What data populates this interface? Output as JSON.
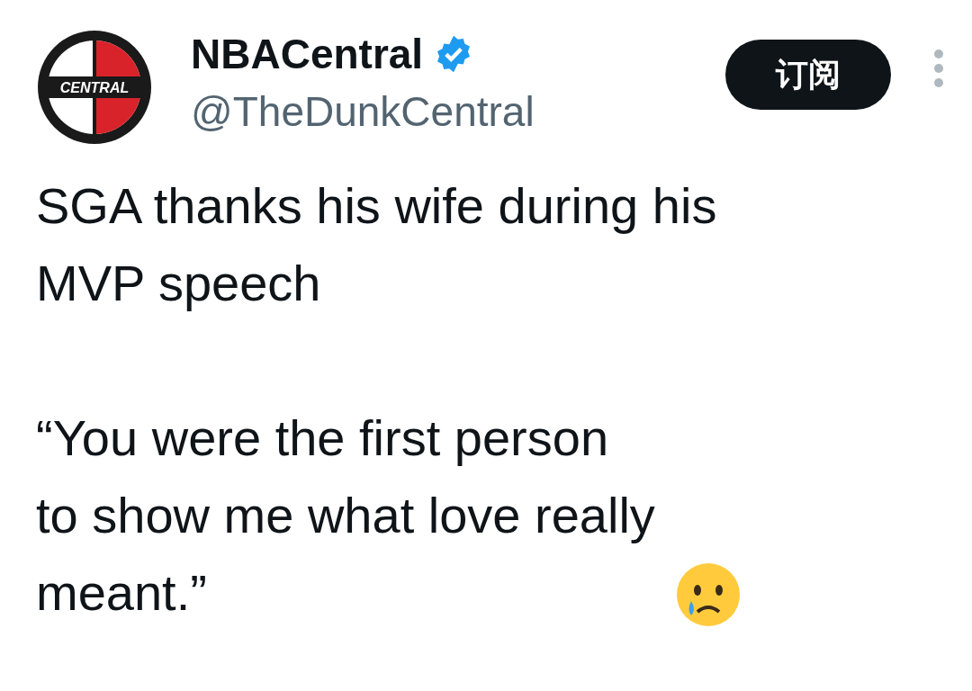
{
  "author": {
    "avatar_text": "CENTRAL",
    "name": "NBACentral",
    "verified": true,
    "handle": "@TheDunkCentral"
  },
  "subscribe_button": {
    "label": "订阅"
  },
  "tweet": {
    "paragraphs": [
      "SGA thanks his wife during his\nMVP speech",
      "“You were the first person\nto show me what love really\nmeant.”"
    ]
  }
}
